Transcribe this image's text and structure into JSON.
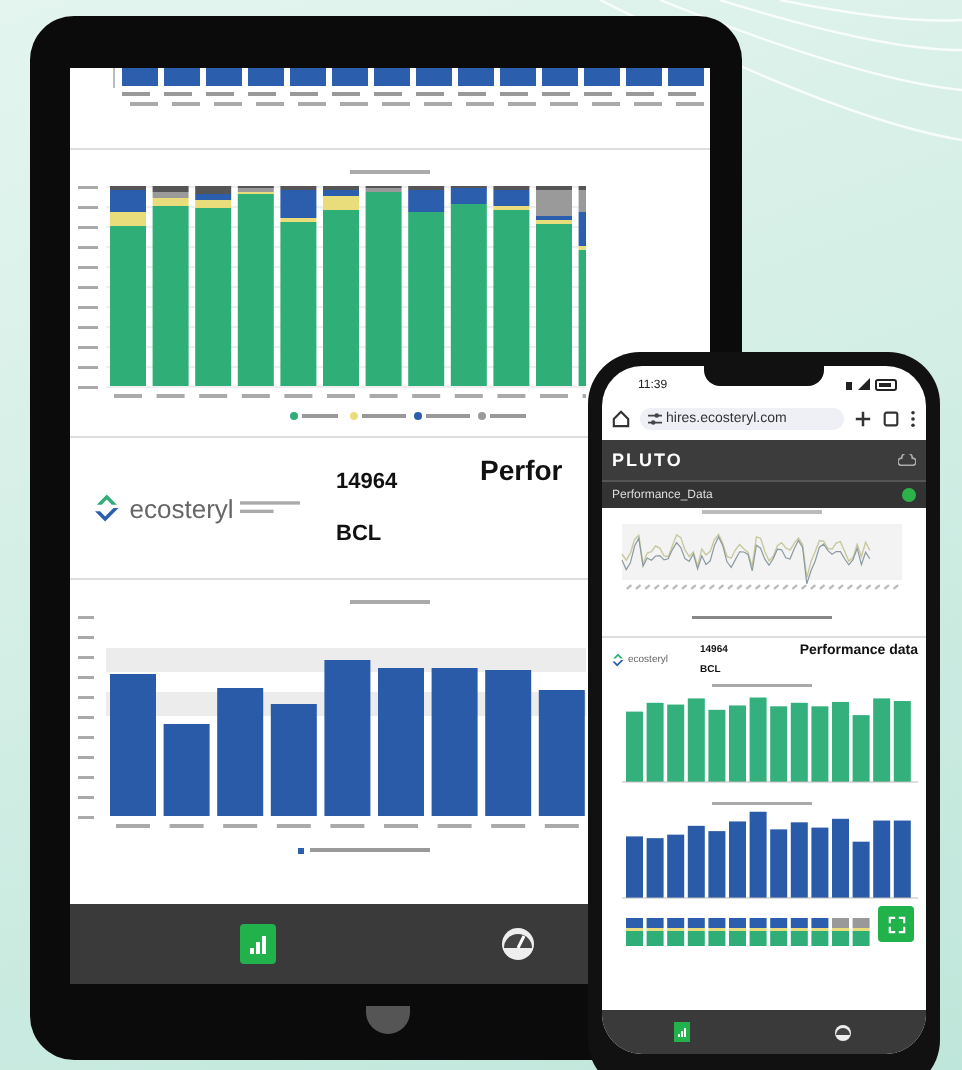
{
  "tablet": {
    "report": {
      "logo_text": "ecosteryl",
      "machine_id": "14964",
      "machine_type": "BCL",
      "title": "Perfor"
    },
    "bottom_nav": [
      {
        "kind": "chart",
        "selected": true
      },
      {
        "kind": "gauge",
        "selected": false
      }
    ]
  },
  "phone": {
    "status_bar": {
      "time": "11:39"
    },
    "browser": {
      "url": "hires.ecosteryl.com"
    },
    "app": {
      "brand": "PLUTO",
      "section": "Performance_Data"
    },
    "report": {
      "logo_text": "ecosteryl",
      "machine_id": "14964",
      "machine_type": "BCL",
      "title": "Performance data"
    },
    "bottom_nav": [
      {
        "kind": "chart",
        "selected": true
      },
      {
        "kind": "gauge",
        "selected": false
      }
    ]
  }
}
